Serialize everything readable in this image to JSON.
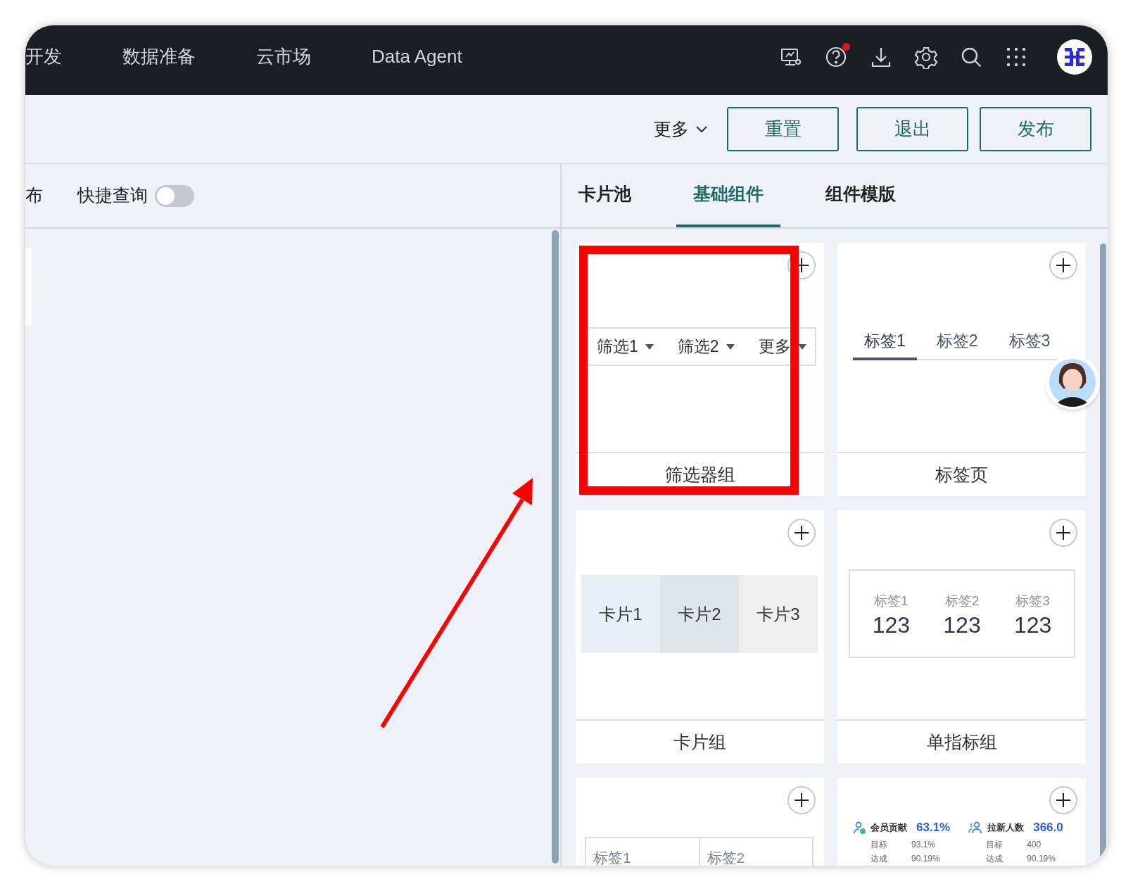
{
  "nav": {
    "items": [
      "开发",
      "数据准备",
      "云市场",
      "Data Agent"
    ],
    "help_alert": true
  },
  "toolbar": {
    "more": "更多",
    "buttons": [
      "重置",
      "退出",
      "发布"
    ]
  },
  "canvas_bar": {
    "label": "布",
    "quick_query": {
      "label": "快捷查询",
      "on": false
    }
  },
  "panel_tabs": [
    {
      "label": "卡片池",
      "selected": false
    },
    {
      "label": "基础组件",
      "selected": true
    },
    {
      "label": "组件模版",
      "selected": false
    }
  ],
  "components": [
    {
      "kind": "filter_group",
      "title": "筛选器组",
      "filters": [
        "筛选1",
        "筛选2",
        "更多"
      ]
    },
    {
      "kind": "tabs",
      "title": "标签页",
      "tabs": [
        {
          "label": "标签1",
          "selected": true
        },
        {
          "label": "标签2",
          "selected": false
        },
        {
          "label": "标签3",
          "selected": false
        }
      ]
    },
    {
      "kind": "card_group",
      "title": "卡片组",
      "cards": [
        "卡片1",
        "卡片2",
        "卡片3"
      ]
    },
    {
      "kind": "indicator_group",
      "title": "单指标组",
      "items": [
        {
          "label": "标签1",
          "value": "123"
        },
        {
          "label": "标签2",
          "value": "123"
        },
        {
          "label": "标签3",
          "value": "123"
        }
      ]
    },
    {
      "kind": "table",
      "cells": [
        "标签1",
        "标签2"
      ]
    },
    {
      "kind": "metrics",
      "metrics": [
        {
          "name": "会员贡献",
          "value": "63.1%",
          "rows": [
            {
              "label": "目标",
              "value": "93.1%"
            },
            {
              "label": "达成",
              "value": "90.19%"
            }
          ]
        },
        {
          "name": "拉新人数",
          "value": "366.0",
          "rows": [
            {
              "label": "目标",
              "value": "400"
            },
            {
              "label": "达成",
              "value": "90.19%"
            }
          ]
        }
      ]
    }
  ]
}
